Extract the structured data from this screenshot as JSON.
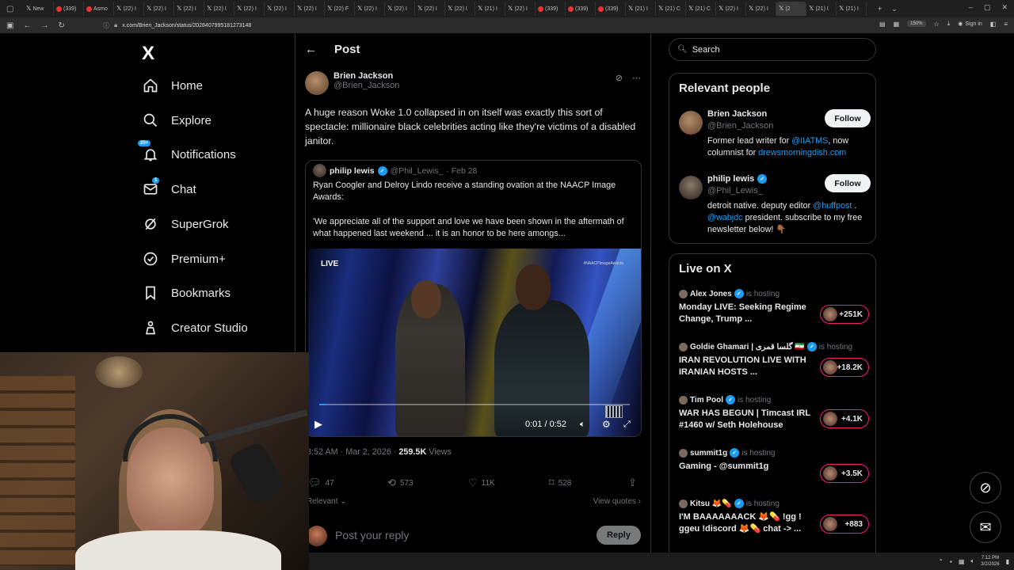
{
  "browser": {
    "tabs": [
      {
        "label": "New",
        "icon": "x-icon"
      },
      {
        "label": "(339)",
        "icon": "youtube-icon"
      },
      {
        "label": "Asmo",
        "icon": "red-icon"
      },
      {
        "label": "(22) I",
        "icon": "x-icon"
      },
      {
        "label": "(22) I",
        "icon": "x-icon"
      },
      {
        "label": "(22) I",
        "icon": "x-icon"
      },
      {
        "label": "(22) I",
        "icon": "x-icon"
      },
      {
        "label": "(22) I",
        "icon": "x-icon"
      },
      {
        "label": "(22) I",
        "icon": "x-icon"
      },
      {
        "label": "(22) I",
        "icon": "x-icon"
      },
      {
        "label": "(22) F",
        "icon": "x-icon"
      },
      {
        "label": "(22) I",
        "icon": "x-icon"
      },
      {
        "label": "(22) I",
        "icon": "x-icon"
      },
      {
        "label": "(22) I",
        "icon": "x-icon"
      },
      {
        "label": "(22) I",
        "icon": "x-icon"
      },
      {
        "label": "(21) I",
        "icon": "x-icon"
      },
      {
        "label": "(22) I",
        "icon": "x-icon"
      },
      {
        "label": "(339)",
        "icon": "youtube-icon"
      },
      {
        "label": "(339)",
        "icon": "youtube-icon"
      },
      {
        "label": "(339)",
        "icon": "youtube-icon"
      },
      {
        "label": "(21) I",
        "icon": "x-icon"
      },
      {
        "label": "(21) C",
        "icon": "x-icon"
      },
      {
        "label": "(21) C",
        "icon": "x-icon"
      },
      {
        "label": "(22) I",
        "icon": "x-icon"
      },
      {
        "label": "(22) I",
        "icon": "x-icon"
      },
      {
        "label": "(2",
        "icon": "x-icon",
        "active": true
      },
      {
        "label": "(21) I",
        "icon": "x-icon"
      },
      {
        "label": "(21) I",
        "icon": "x-icon"
      }
    ],
    "url": "x.com/Brien_Jackson/status/2028407995181273148",
    "zoom": "150%",
    "signin": "Sign in"
  },
  "sidebar": {
    "logo": "X",
    "items": [
      {
        "label": "Home",
        "icon": "home-icon"
      },
      {
        "label": "Explore",
        "icon": "search-icon"
      },
      {
        "label": "Notifications",
        "icon": "bell-icon",
        "badge": "20+"
      },
      {
        "label": "Chat",
        "icon": "mail-icon",
        "badge": "1"
      },
      {
        "label": "SuperGrok",
        "icon": "grok-icon"
      },
      {
        "label": "Premium+",
        "icon": "premium-icon"
      },
      {
        "label": "Bookmarks",
        "icon": "bookmark-icon"
      },
      {
        "label": "Creator Studio",
        "icon": "creator-studio-icon"
      }
    ]
  },
  "post": {
    "header": "Post",
    "author_name": "Brien Jackson",
    "author_handle": "@Brien_Jackson",
    "text": "A huge reason Woke 1.0 collapsed in on itself was exactly this sort of spectacle: millionaire black celebrities acting like they're victims of a disabled janitor.",
    "quote": {
      "name": "philip lewis",
      "handle": "@Phil_Lewis_",
      "date": "· Feb 28",
      "line1": "Ryan Coogler and Delroy Lindo receive a standing ovation at the NAACP Image Awards:",
      "line2": "'We appreciate all of the support and love we have been shown in the aftermath of what happened last weekend ... it is an honor to be here amongs...",
      "video": {
        "live_label": "LIVE",
        "watermark": "#NAACPImageAwards",
        "time": "0:01 / 0:52",
        "progress_fraction": 0.02
      }
    },
    "meta_time": "8:52 AM · Mar 2, 2026 · ",
    "meta_views": "259.5K",
    "meta_views_label": " Views",
    "stats": {
      "replies": "47",
      "reposts": "573",
      "likes": "11K",
      "bookmarks": "528"
    },
    "sort_label": "Relevant",
    "view_quotes": "View quotes",
    "reply_placeholder": "Post your reply",
    "reply_button": "Reply"
  },
  "right": {
    "search_placeholder": "Search",
    "relevant_title": "Relevant people",
    "people": [
      {
        "name": "Brien Jackson",
        "handle": "@Brien_Jackson",
        "verified": false,
        "bio_parts": [
          "Former lead writer for ",
          "@IIATMS",
          ", now columnist for ",
          "drewsmorningdish.com"
        ],
        "follow": "Follow"
      },
      {
        "name": "philip lewis",
        "handle": "@Phil_Lewis_",
        "verified": true,
        "bio_parts": [
          "detroit native. deputy editor ",
          "@huffpost",
          " . ",
          "@wabjdc",
          " president. subscribe to my free newsletter below! 👇🏾"
        ],
        "follow": "Follow"
      }
    ],
    "live_title": "Live on X",
    "live": [
      {
        "host": "Alex Jones",
        "hosting": "is hosting",
        "title": "Monday LIVE: Seeking Regime Change, Trump ...",
        "count": "+251K"
      },
      {
        "host": "Goldie Ghamari | گلسا قمری 🇮🇷",
        "hosting": "is hosting",
        "title": "IRAN REVOLUTION LIVE WITH IRANIAN HOSTS ...",
        "count": "+18.2K"
      },
      {
        "host": "Tim Pool",
        "hosting": "is hosting",
        "title": "WAR HAS BEGUN | Timcast IRL #1460 w/ Seth Holehouse",
        "count": "+4.1K"
      },
      {
        "host": "summit1g",
        "hosting": "is hosting",
        "title": "Gaming - @summit1g",
        "count": "+3.5K"
      },
      {
        "host": "Kitsu 🦊💊",
        "hosting": "is hosting",
        "title": "I'M BAAAAAAACK 🦊💊 !gg ! ggeu !discord 🦊💊 chat -> ...",
        "count": "+883"
      }
    ]
  },
  "taskbar": {
    "time": "7:12 PM",
    "date": "3/2/2026"
  },
  "colors": {
    "accent": "#1d9bf0",
    "live_ring": "#f91880",
    "border": "#2f3336",
    "muted": "#71767b"
  }
}
